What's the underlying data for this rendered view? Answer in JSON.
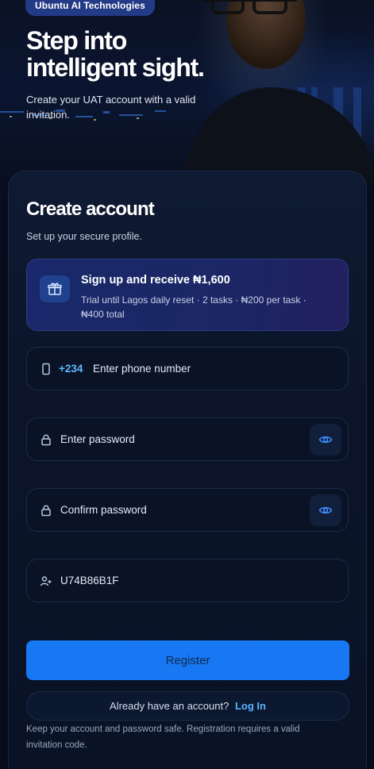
{
  "hero": {
    "brand": "Ubuntu AI Technologies",
    "title": "Step into intelligent sight.",
    "subtitle": "Create your UAT account with a valid invitation."
  },
  "form": {
    "title": "Create account",
    "subtitle": "Set up your secure profile.",
    "promo": {
      "icon": "gift-icon",
      "title": "Sign up and receive ₦1,600",
      "description": "Trial until Lagos daily reset · 2 tasks · ₦200 per task · ₦400 total"
    },
    "phone": {
      "prefix": "+234",
      "placeholder": "Enter phone number",
      "icon": "phone-icon"
    },
    "password": {
      "placeholder": "Enter password",
      "icon": "lock-icon",
      "toggle_icon": "eye-icon"
    },
    "confirm_password": {
      "placeholder": "Confirm password",
      "icon": "lock-icon",
      "toggle_icon": "eye-icon"
    },
    "invite": {
      "value": "U74B86B1F",
      "icon": "user-plus-icon"
    },
    "register_label": "Register",
    "login_prompt": "Already have an account?",
    "login_link": "Log In",
    "footer_note": "Keep your account and password safe. Registration requires a valid invitation code."
  },
  "colors": {
    "background": "#070d1c",
    "accent": "#1877f2",
    "link": "#59b4ff",
    "promo": "#1b2766"
  }
}
